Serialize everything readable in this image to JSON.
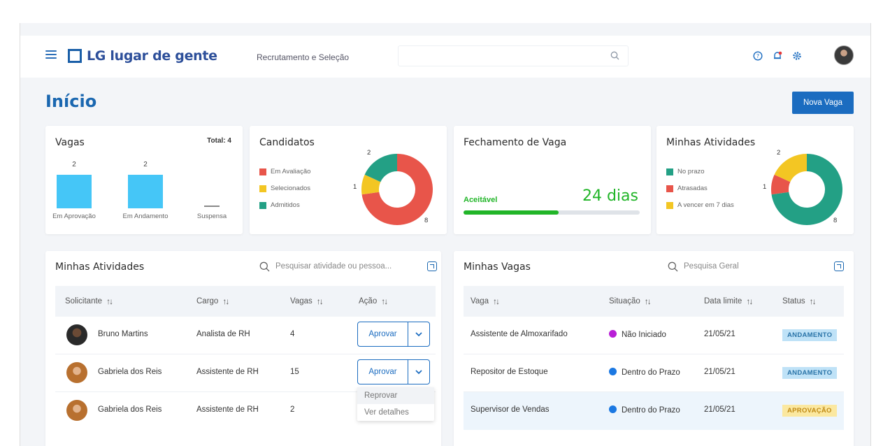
{
  "header": {
    "logo_text": "LG lugar de gente",
    "module": "Recrutamento e Seleção",
    "search_placeholder": ""
  },
  "page": {
    "title": "Início",
    "new_button": "Nova Vaga"
  },
  "vagas_card": {
    "title": "Vagas",
    "total": "Total: 4",
    "chart_data": {
      "type": "bar",
      "categories": [
        "Em Aprovação",
        "Em Andamento",
        "Suspensa"
      ],
      "values": [
        2,
        2,
        0
      ],
      "value_labels": [
        "2",
        "2",
        ""
      ]
    }
  },
  "candidatos_card": {
    "title": "Candidatos",
    "legend": [
      "Em Avaliação",
      "Selecionados",
      "Admitidos"
    ],
    "chart_data": {
      "type": "pie",
      "categories": [
        "Em Avaliação",
        "Selecionados",
        "Admitidos"
      ],
      "values": [
        8,
        1,
        2
      ],
      "colors": [
        "#e8554a",
        "#f3c623",
        "#23a085"
      ]
    },
    "labels": {
      "top": "2",
      "left": "1",
      "bottom": "8"
    }
  },
  "fechamento_card": {
    "title": "Fechamento de Vaga",
    "status": "Aceitável",
    "value": "24 dias",
    "progress": 0.54
  },
  "atividades_card": {
    "title": "Minhas Atividades",
    "legend": [
      "No prazo",
      "Atrasadas",
      "A vencer em 7 dias"
    ],
    "chart_data": {
      "type": "pie",
      "categories": [
        "No prazo",
        "Atrasadas",
        "A vencer em 7 dias"
      ],
      "values": [
        8,
        1,
        2
      ],
      "colors": [
        "#23a085",
        "#e8554a",
        "#f3c623"
      ]
    },
    "labels": {
      "top": "2",
      "left": "1",
      "bottom": "8"
    }
  },
  "atividades_table": {
    "title": "Minhas Atividades",
    "search_placeholder": "Pesquisar atividade ou pessoa...",
    "columns": [
      "Solicitante",
      "Cargo",
      "Vagas",
      "Ação"
    ],
    "rows": [
      {
        "name": "Bruno Martins",
        "cargo": "Analista de RH",
        "vagas": "4",
        "action": "Aprovar"
      },
      {
        "name": "Gabriela dos Reis",
        "cargo": "Assistente de RH",
        "vagas": "15",
        "action": "Aprovar"
      },
      {
        "name": "Gabriela dos Reis",
        "cargo": "Assistente de RH",
        "vagas": "2",
        "action": ""
      }
    ],
    "dropdown": [
      "Reprovar",
      "Ver detalhes"
    ]
  },
  "vagas_table": {
    "title": "Minhas Vagas",
    "search_placeholder": "Pesquisa Geral",
    "columns": [
      "Vaga",
      "Situação",
      "Data limite",
      "Status"
    ],
    "rows": [
      {
        "vaga": "Assistente de Almoxarifado",
        "situacao": "Não Iniciado",
        "color": "#b81fd6",
        "data": "21/05/21",
        "status": "ANDAMENTO"
      },
      {
        "vaga": "Repositor de Estoque",
        "situacao": "Dentro do Prazo",
        "color": "#1b78e2",
        "data": "21/05/21",
        "status": "ANDAMENTO"
      },
      {
        "vaga": "Supervisor de Vendas",
        "situacao": "Dentro do Prazo",
        "color": "#1b78e2",
        "data": "21/05/21",
        "status": "APROVAÇÃO"
      }
    ]
  }
}
